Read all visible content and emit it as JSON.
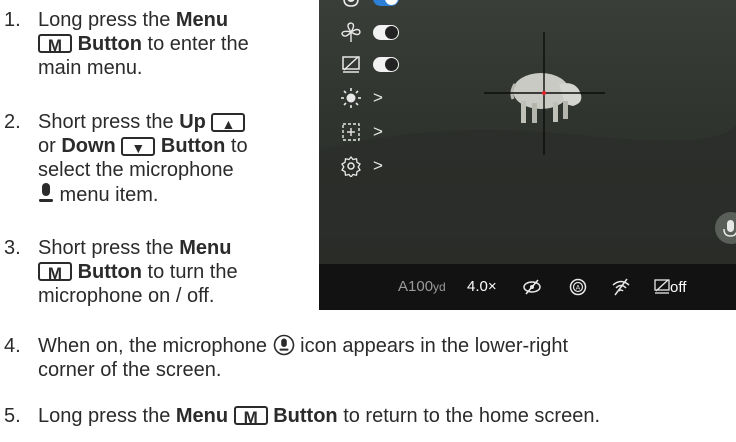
{
  "steps": [
    {
      "number": "1.",
      "line1_pre": "Long press the ",
      "line1_bold": "Menu",
      "key_label": "M",
      "line2_bold": "Button",
      "line2_post": " to enter the",
      "line3": "main menu."
    },
    {
      "number": "2.",
      "line1_pre": "Short press the ",
      "line1_bold": "Up",
      "key_up": "▲",
      "line2_pre": "or ",
      "line2_bold": "Down",
      "key_down": "▼",
      "line2_bold2": "Button",
      "line2_post": " to",
      "line3": "select the microphone",
      "line4_post": " menu item."
    },
    {
      "number": "3.",
      "line1_pre": "Short press the ",
      "line1_bold": "Menu",
      "key_label": "M",
      "line2_bold": "Button",
      "line2_post": " to turn the",
      "line3": "microphone on / off."
    },
    {
      "number": "4.",
      "line1_pre": "When on, the microphone ",
      "line1_post": " icon appears in the lower-right",
      "line2": "corner of the screen."
    },
    {
      "number": "5.",
      "line1_pre": "Long press the ",
      "line1_bold": "Menu",
      "key_label": "M",
      "line1_bold2": "Button",
      "line1_post": " to return to the home screen."
    }
  ],
  "screen": {
    "menu_items": [
      {
        "icon": "microphone-icon",
        "control": "toggle-on"
      },
      {
        "icon": "fan-icon",
        "control": "toggle-off"
      },
      {
        "icon": "display-off-icon",
        "control": "toggle-off"
      },
      {
        "icon": "brightness-icon",
        "control": "chevron",
        "chevron": ">"
      },
      {
        "icon": "zoom-frame-icon",
        "control": "chevron",
        "chevron": ">"
      },
      {
        "icon": "settings-gear-icon",
        "control": "chevron",
        "chevron": ">"
      }
    ],
    "status_bar": {
      "range_value": "A100",
      "range_unit": "yd",
      "zoom": "4.0×",
      "display_off_label": "off"
    },
    "colors": {
      "toggle_on": "#2e7fd6",
      "reticle_dot": "#d8262b",
      "status_bar": "#121212"
    }
  }
}
